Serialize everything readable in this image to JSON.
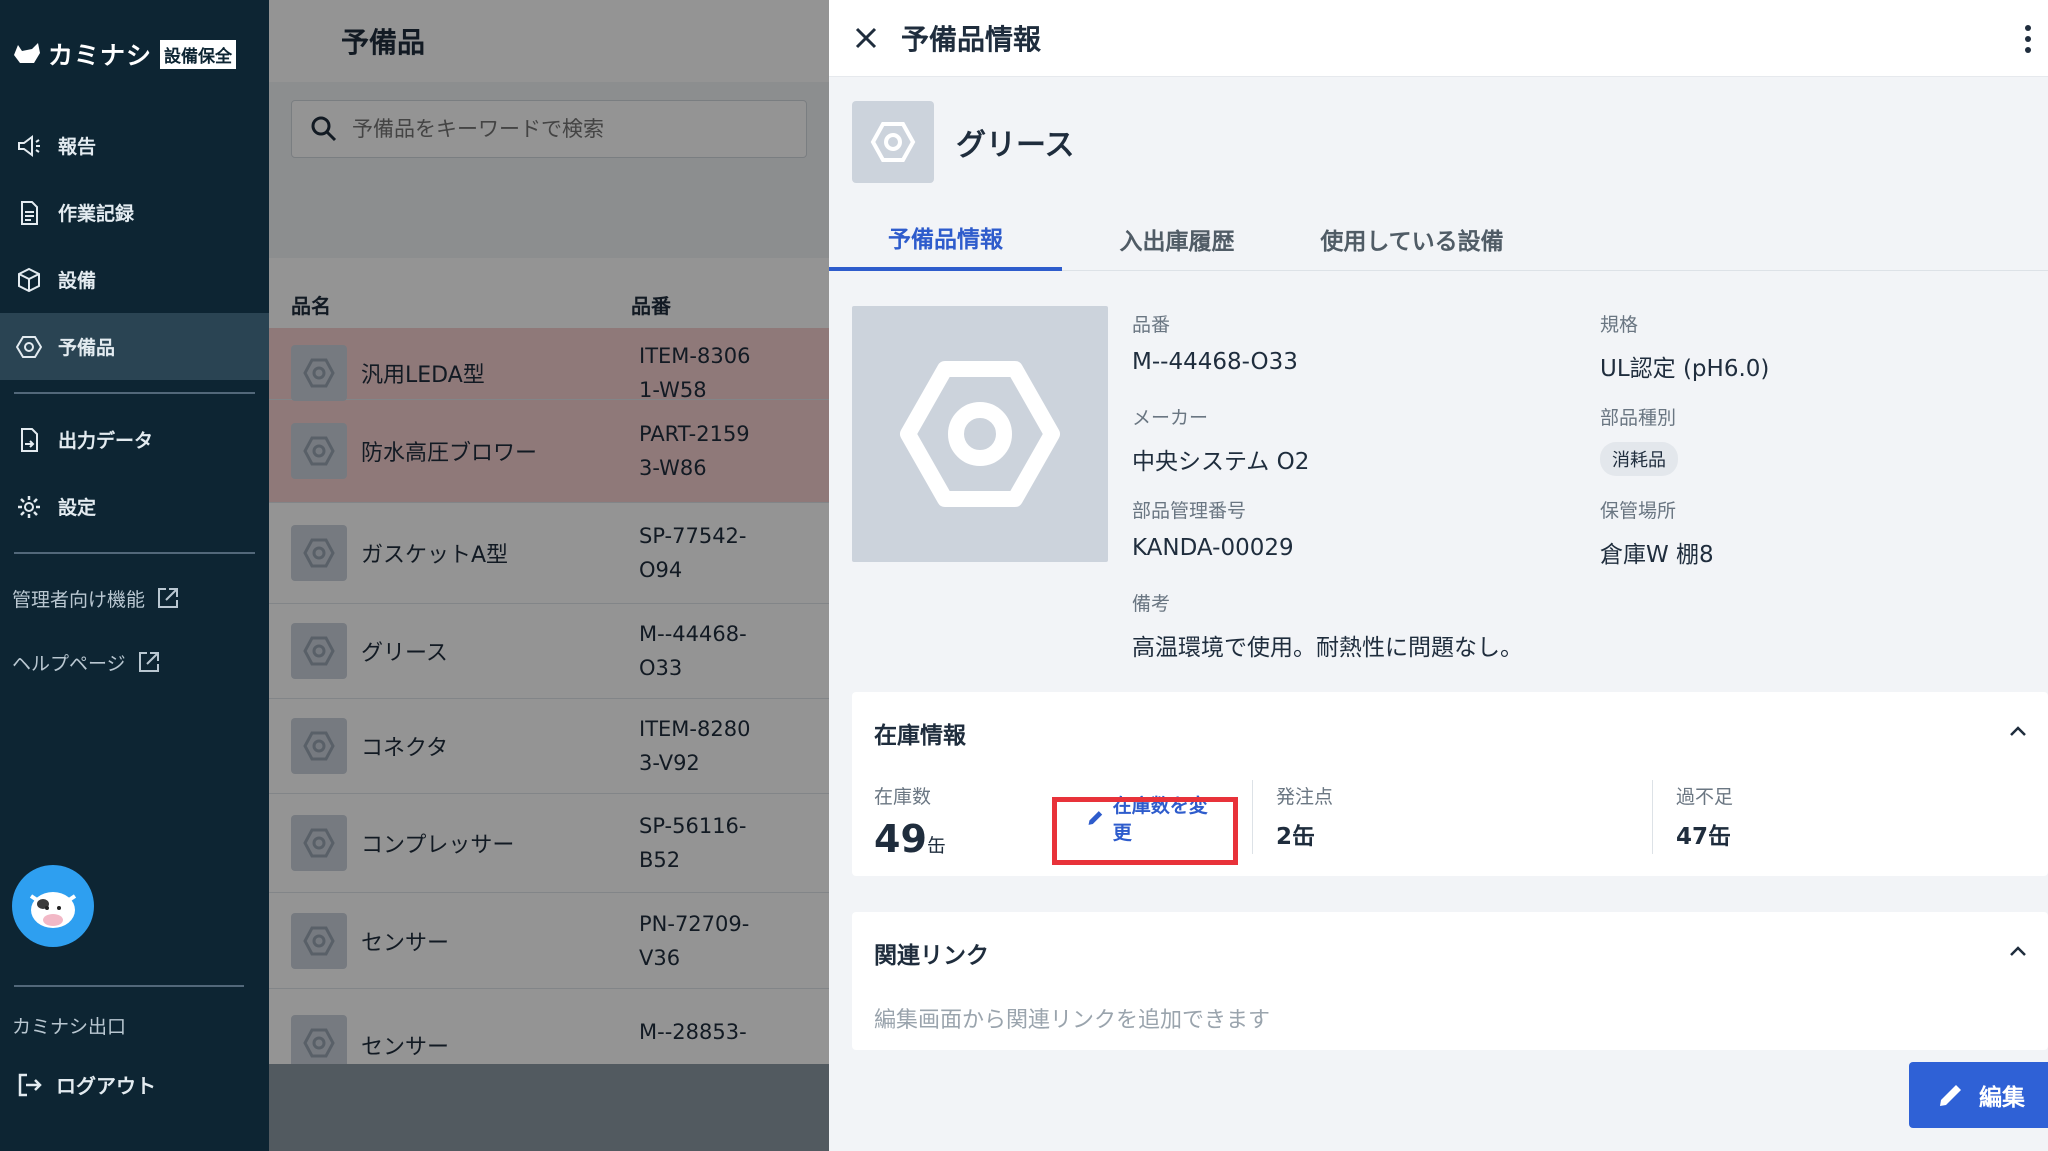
{
  "sidebar": {
    "logo_text": "カミナシ",
    "logo_badge": "設備保全",
    "nav": [
      {
        "label": "報告"
      },
      {
        "label": "作業記録"
      },
      {
        "label": "設備"
      },
      {
        "label": "予備品"
      },
      {
        "label": "出力データ"
      },
      {
        "label": "設定"
      }
    ],
    "links": [
      {
        "label": "管理者向け機能"
      },
      {
        "label": "ヘルプページ"
      }
    ],
    "footer": "カミナシ出口",
    "logout": "ログアウト"
  },
  "list": {
    "title": "予備品",
    "search_placeholder": "予備品をキーワードで検索",
    "col_name": "品名",
    "col_code": "品番",
    "rows": [
      {
        "name": "汎用LEDA型",
        "code": "ITEM-83061-W58"
      },
      {
        "name": "防水高圧ブロワー",
        "code": "PART-21593-W86"
      },
      {
        "name": "ガスケットA型",
        "code": "SP-77542-O94"
      },
      {
        "name": "グリース",
        "code": "M--44468-O33"
      },
      {
        "name": "コネクタ",
        "code": "ITEM-82803-V92"
      },
      {
        "name": "コンプレッサー",
        "code": "SP-56116-B52"
      },
      {
        "name": "センサー",
        "code": "PN-72709-V36"
      },
      {
        "name": "センサー",
        "code": "M--28853-"
      }
    ]
  },
  "panel": {
    "title": "予備品情報",
    "item_name": "グリース",
    "tabs": [
      {
        "label": "予備品情報"
      },
      {
        "label": "入出庫履歴"
      },
      {
        "label": "使用している設備"
      }
    ],
    "fields": {
      "code_label": "品番",
      "code": "M--44468-O33",
      "spec_label": "規格",
      "spec": "UL認定 (pH6.0)",
      "maker_label": "メーカー",
      "maker": "中央システム O2",
      "category_label": "部品種別",
      "category": "消耗品",
      "mgmt_label": "部品管理番号",
      "mgmt": "KANDA-00029",
      "location_label": "保管場所",
      "location": "倉庫W 棚8",
      "note_label": "備考",
      "note": "高温環境で使用。耐熱性に問題なし。"
    },
    "stock": {
      "title": "在庫情報",
      "qty_label": "在庫数",
      "qty": "49",
      "unit": "缶",
      "change_label": "在庫数を変更",
      "reorder_label": "発注点",
      "reorder": "2缶",
      "shortage_label": "過不足",
      "shortage": "47缶"
    },
    "links": {
      "title": "関連リンク",
      "hint": "編集画面から関連リンクを追加できます"
    },
    "edit_label": "編集"
  },
  "colors": {
    "accent": "#2e5ccc",
    "sidebar_bg": "#0d2533",
    "highlight": "#e8323a",
    "alert_row": "#f7d0d0"
  }
}
